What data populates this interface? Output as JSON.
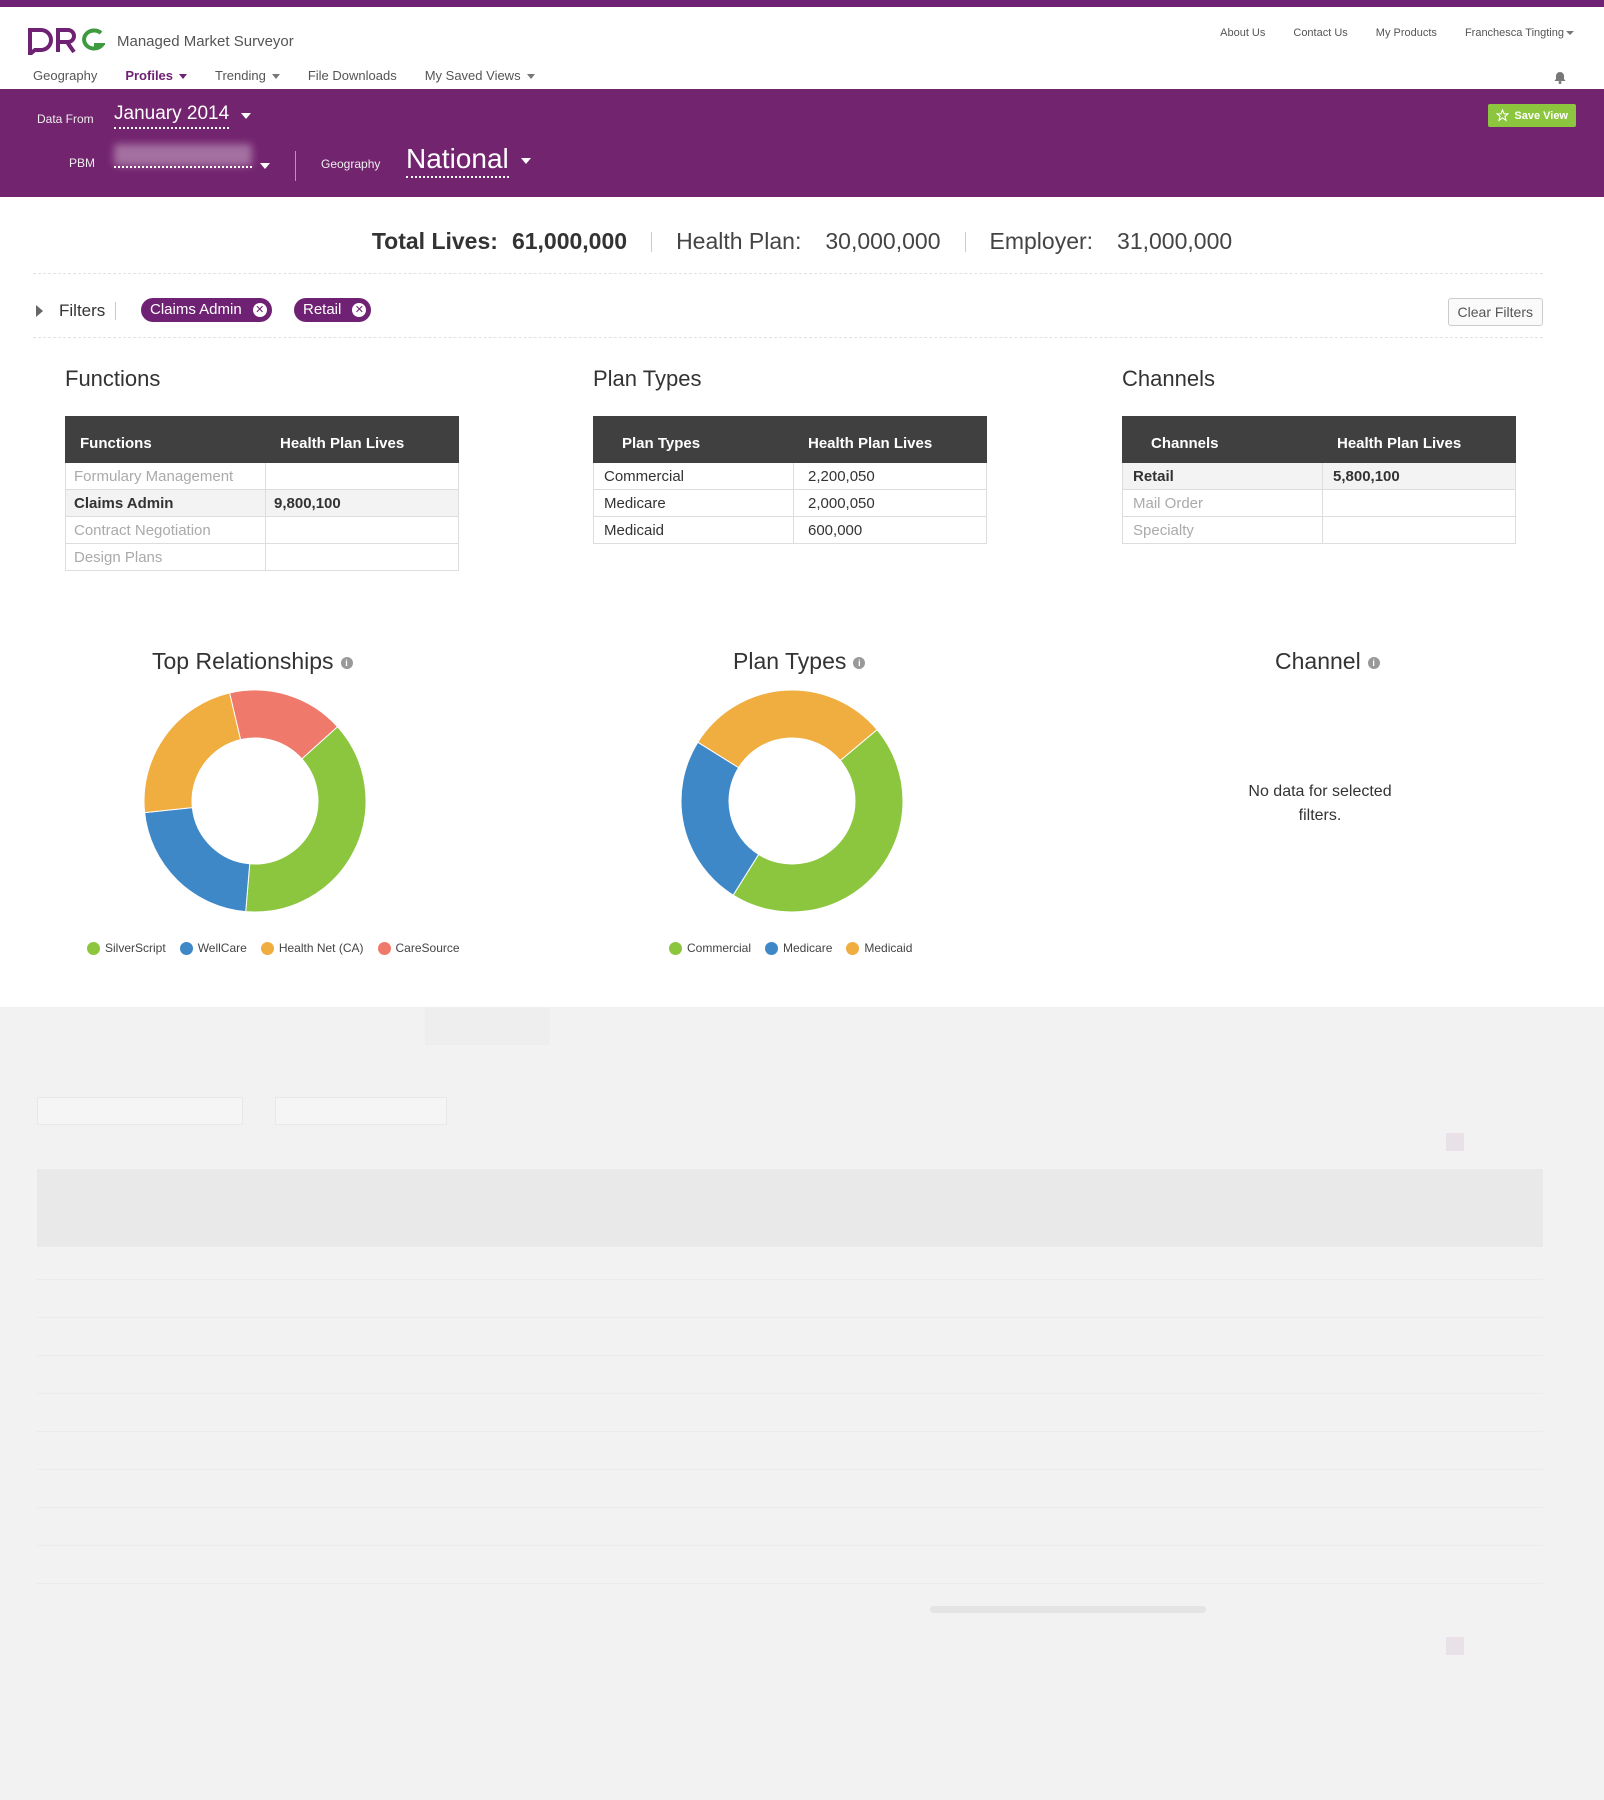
{
  "app": {
    "brand": "DRG",
    "title": "Managed Market Surveyor"
  },
  "colors": {
    "brand_purple": "#73246f",
    "accent_green": "#8cc63f",
    "series_green": "#8cc63f",
    "series_blue": "#3f88c8",
    "series_orange": "#f0ad40",
    "series_red": "#ef7a6b"
  },
  "top_links": [
    "About Us",
    "Contact Us",
    "My Products",
    "Franchesca Tingting"
  ],
  "nav": {
    "geography": "Geography",
    "profiles": "Profiles",
    "trending": "Trending",
    "file_downloads": "File Downloads",
    "saved_views": "My Saved Views"
  },
  "header": {
    "data_from_label": "Data From",
    "data_from_value": "January 2014",
    "pbm_label": "PBM",
    "geography_label": "Geography",
    "geography_value": "National",
    "save_view": "Save View"
  },
  "totals": {
    "total_label": "Total Lives:",
    "total_value": "61,000,000",
    "health_plan_label": "Health Plan:",
    "health_plan_value": "30,000,000",
    "employer_label": "Employer:",
    "employer_value": "31,000,000"
  },
  "filters": {
    "label": "Filters",
    "chips": [
      "Claims Admin",
      "Retail"
    ],
    "clear": "Clear Filters"
  },
  "functions": {
    "title": "Functions",
    "headers": [
      "Functions",
      "Health Plan Lives"
    ],
    "rows": [
      [
        "Formulary Management",
        ""
      ],
      [
        "Claims Admin",
        "9,800,100"
      ],
      [
        "Contract Negotiation",
        ""
      ],
      [
        "Design Plans",
        ""
      ]
    ]
  },
  "plan_types": {
    "title": "Plan Types",
    "headers": [
      "Plan Types",
      "Health Plan Lives"
    ],
    "rows": [
      [
        "Commercial",
        "2,200,050"
      ],
      [
        "Medicare",
        "2,000,050"
      ],
      [
        "Medicaid",
        "600,000"
      ]
    ]
  },
  "channels": {
    "title": "Channels",
    "headers": [
      "Channels",
      "Health Plan Lives"
    ],
    "rows": [
      [
        "Retail",
        "5,800,100"
      ],
      [
        "Mail Order",
        ""
      ],
      [
        "Specialty",
        ""
      ]
    ]
  },
  "charts": {
    "relationships_title": "Top Relationships",
    "plan_types_title": "Plan Types",
    "channel_title": "Channel",
    "no_data": "No data for selected filters."
  },
  "chart_data": [
    {
      "type": "pie",
      "title": "Top Relationships",
      "categories": [
        "SilverScript",
        "WellCare",
        "Health Net (CA)",
        "CareSource"
      ],
      "values": [
        38,
        22,
        23,
        17
      ],
      "colors": [
        "#8cc63f",
        "#3f88c8",
        "#f0ad40",
        "#ef7a6b"
      ],
      "legend": "bottom"
    },
    {
      "type": "pie",
      "title": "Plan Types",
      "categories": [
        "Commercial",
        "Medicare",
        "Medicaid"
      ],
      "values": [
        45,
        25,
        30
      ],
      "colors": [
        "#8cc63f",
        "#3f88c8",
        "#f0ad40"
      ],
      "legend": "bottom"
    }
  ]
}
